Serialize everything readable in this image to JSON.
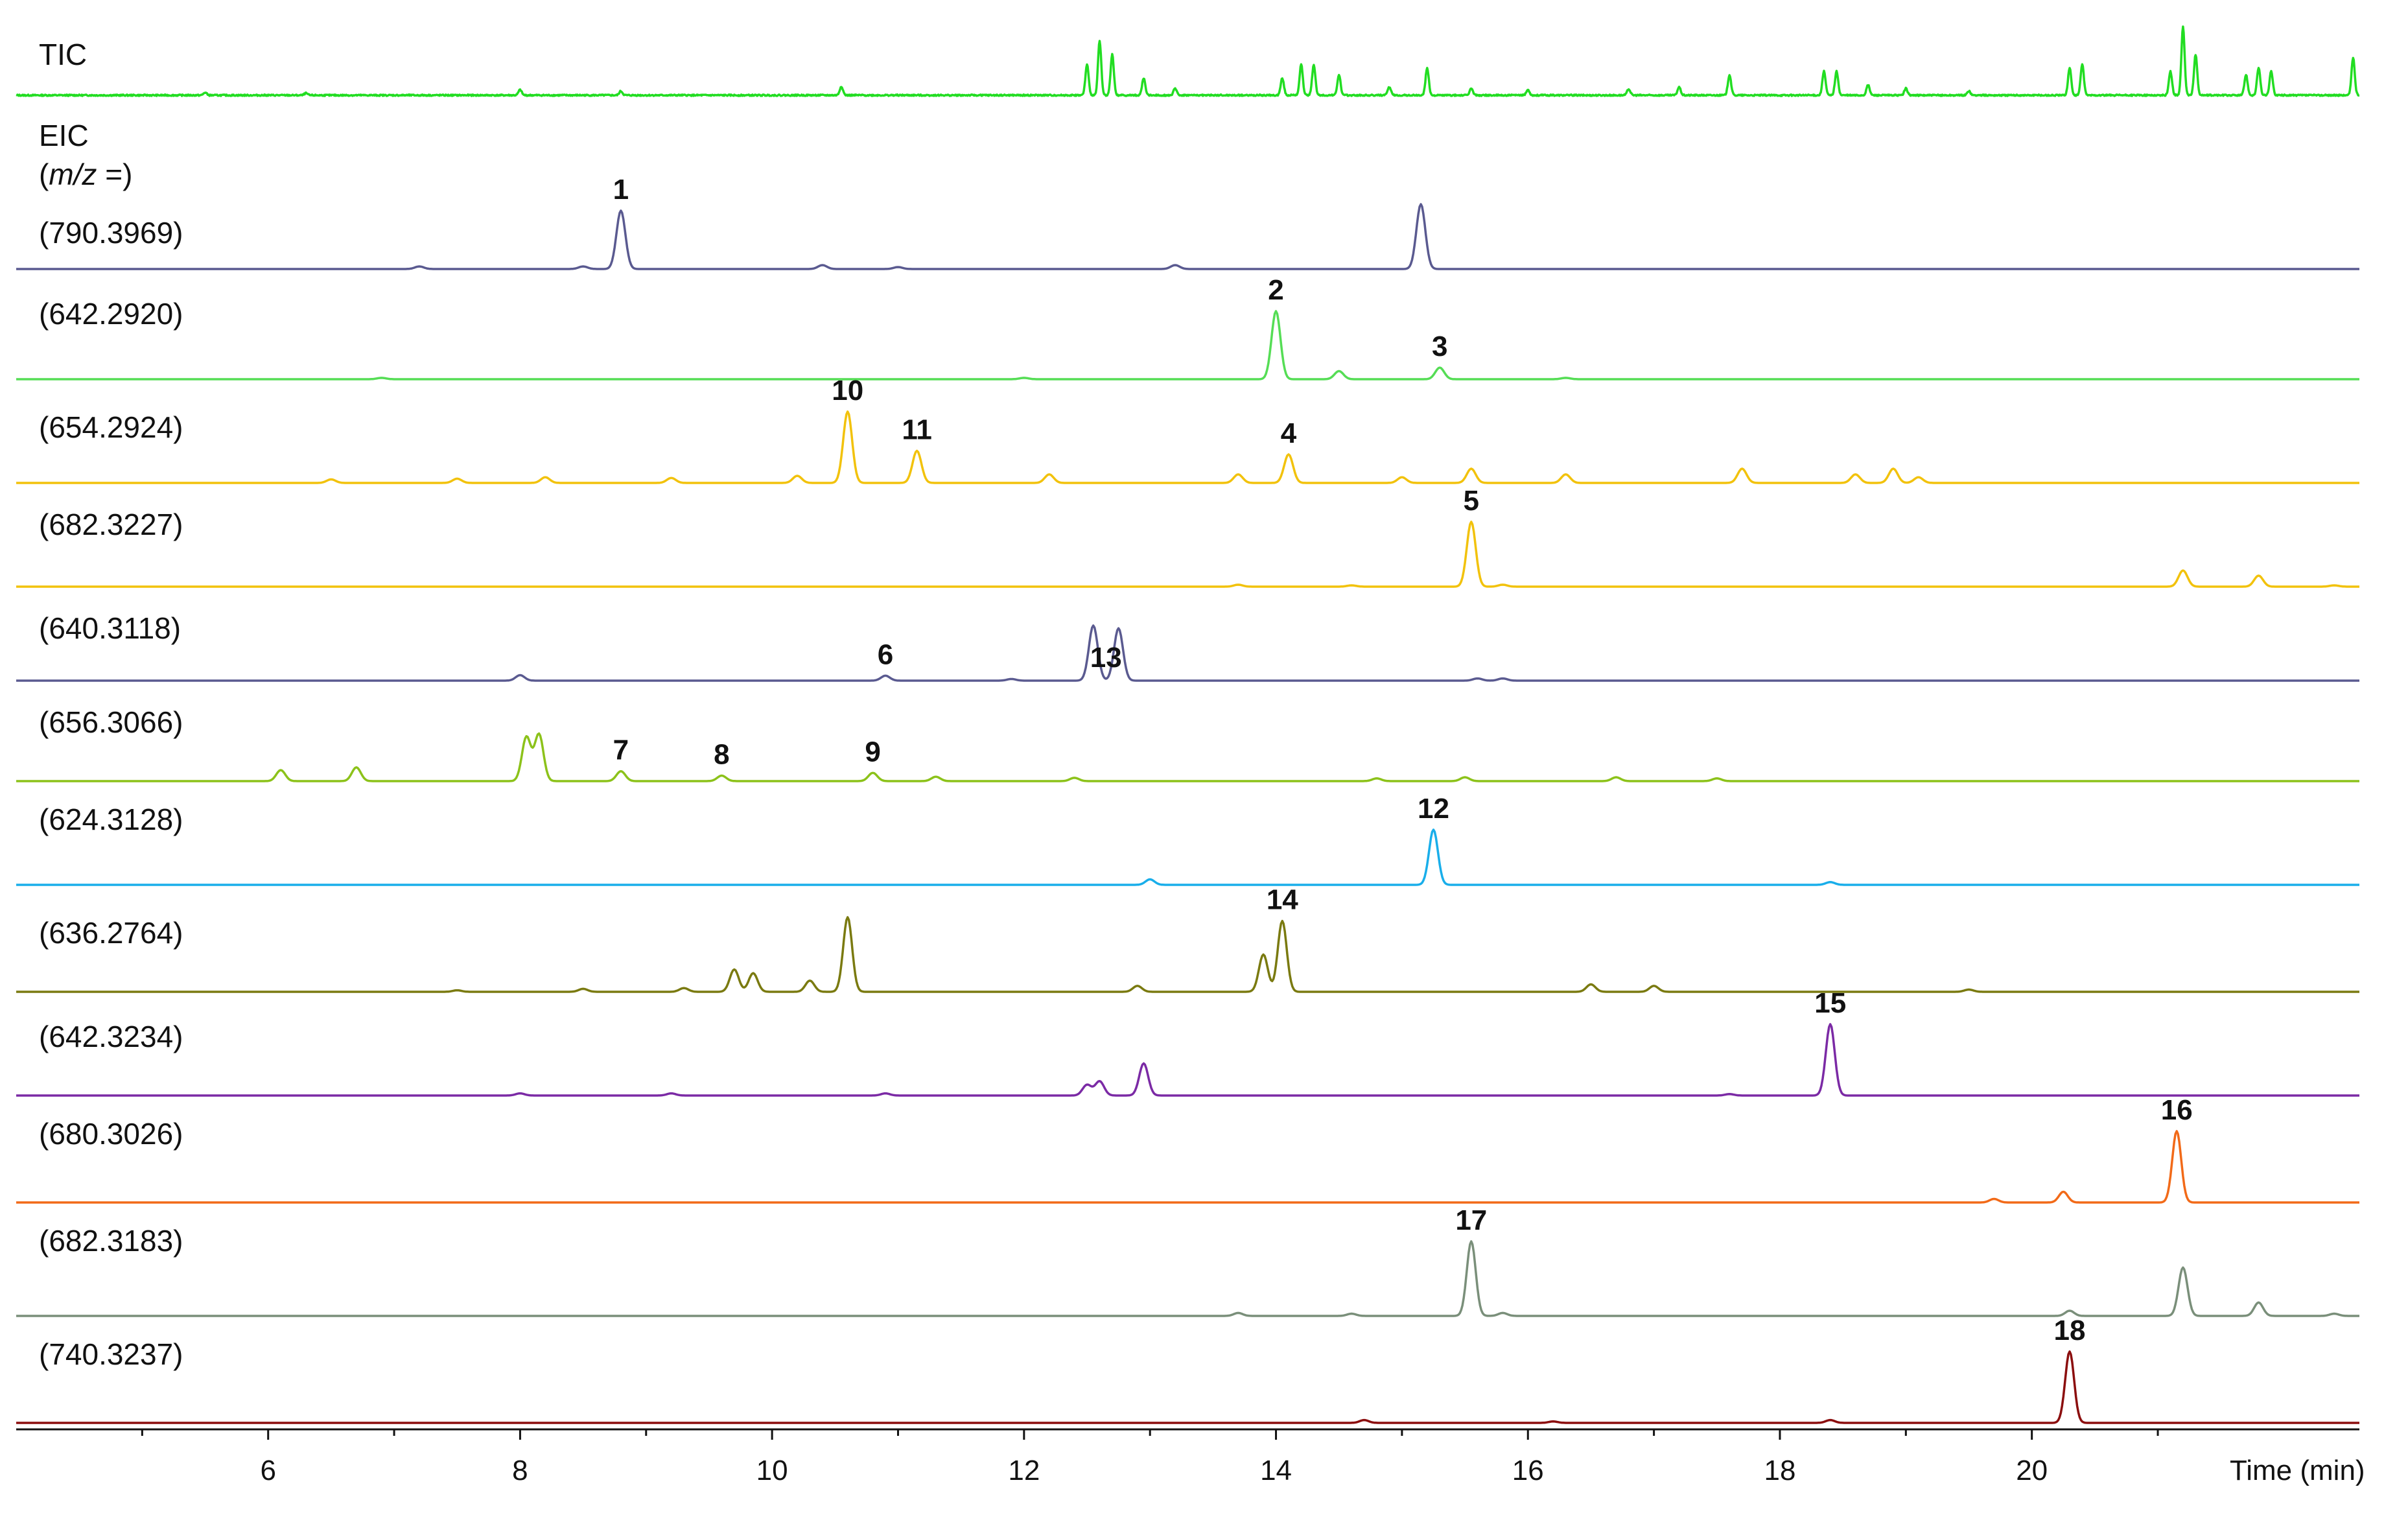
{
  "chart_data": {
    "type": "line",
    "x_axis": {
      "label": "Time (min)",
      "range": [
        4.0,
        22.6
      ],
      "major_ticks": [
        6,
        8,
        10,
        12,
        14,
        16,
        18,
        20
      ],
      "minor_ticks": [
        5,
        7,
        9,
        11,
        13,
        15,
        17,
        19,
        21
      ]
    },
    "traces": [
      {
        "id": "tic",
        "label": "TIC",
        "color": "#22dd22",
        "baseline": 0.02,
        "peaks": [
          [
            5.5,
            0.04
          ],
          [
            6.3,
            0.03
          ],
          [
            8.0,
            0.08
          ],
          [
            8.8,
            0.06
          ],
          [
            10.55,
            0.13
          ],
          [
            12.5,
            0.45
          ],
          [
            12.6,
            0.8
          ],
          [
            12.7,
            0.6
          ],
          [
            12.95,
            0.25
          ],
          [
            13.2,
            0.1
          ],
          [
            14.05,
            0.25
          ],
          [
            14.2,
            0.45
          ],
          [
            14.3,
            0.45
          ],
          [
            14.5,
            0.3
          ],
          [
            14.9,
            0.12
          ],
          [
            15.2,
            0.4
          ],
          [
            15.55,
            0.1
          ],
          [
            16.0,
            0.08
          ],
          [
            16.8,
            0.09
          ],
          [
            17.2,
            0.12
          ],
          [
            17.6,
            0.3
          ],
          [
            18.35,
            0.35
          ],
          [
            18.45,
            0.35
          ],
          [
            18.7,
            0.15
          ],
          [
            19.0,
            0.1
          ],
          [
            19.5,
            0.06
          ],
          [
            20.3,
            0.4
          ],
          [
            20.4,
            0.45
          ],
          [
            21.1,
            0.35
          ],
          [
            21.2,
            1.0
          ],
          [
            21.3,
            0.6
          ],
          [
            21.7,
            0.3
          ],
          [
            21.8,
            0.4
          ],
          [
            21.9,
            0.35
          ],
          [
            22.55,
            0.55
          ]
        ]
      },
      {
        "id": "eic",
        "label_line1": "EIC",
        "label_line2": "(m/z =)"
      },
      {
        "id": "t790",
        "label": "(790.3969)",
        "color": "#5a5a90",
        "peaks": [
          [
            7.2,
            0.04
          ],
          [
            8.5,
            0.04
          ],
          [
            8.8,
            0.9
          ],
          [
            10.4,
            0.06
          ],
          [
            11.0,
            0.03
          ],
          [
            13.2,
            0.06
          ],
          [
            15.15,
            1.0
          ]
        ],
        "annotations": [
          {
            "number": "1",
            "x": 8.8
          }
        ]
      },
      {
        "id": "t642a",
        "label": "(642.2920)",
        "color": "#55dd55",
        "peaks": [
          [
            6.9,
            0.02
          ],
          [
            12.0,
            0.02
          ],
          [
            14.0,
            1.0
          ],
          [
            14.5,
            0.12
          ],
          [
            15.3,
            0.17
          ],
          [
            16.3,
            0.02
          ]
        ],
        "annotations": [
          {
            "number": "2",
            "x": 14.0
          },
          {
            "number": "3",
            "x": 15.3
          }
        ]
      },
      {
        "id": "t654",
        "label": "(654.2924)",
        "color": "#f2c20c",
        "peaks": [
          [
            6.5,
            0.05
          ],
          [
            7.5,
            0.06
          ],
          [
            8.2,
            0.08
          ],
          [
            9.2,
            0.07
          ],
          [
            10.2,
            0.1
          ],
          [
            10.6,
            1.0
          ],
          [
            11.15,
            0.45
          ],
          [
            12.2,
            0.12
          ],
          [
            13.7,
            0.12
          ],
          [
            14.1,
            0.4
          ],
          [
            15.0,
            0.08
          ],
          [
            15.55,
            0.2
          ],
          [
            16.3,
            0.12
          ],
          [
            17.7,
            0.2
          ],
          [
            18.6,
            0.12
          ],
          [
            18.9,
            0.2
          ],
          [
            19.1,
            0.08
          ]
        ],
        "annotations": [
          {
            "number": "10",
            "x": 10.6
          },
          {
            "number": "11",
            "x": 11.15
          },
          {
            "number": "4",
            "x": 14.1
          }
        ]
      },
      {
        "id": "t682a",
        "label": "(682.3227)",
        "color": "#f2c20c",
        "peaks": [
          [
            13.7,
            0.03
          ],
          [
            14.6,
            0.02
          ],
          [
            15.55,
            1.0
          ],
          [
            15.8,
            0.03
          ],
          [
            21.2,
            0.25
          ],
          [
            21.8,
            0.17
          ],
          [
            22.4,
            0.02
          ]
        ],
        "annotations": [
          {
            "number": "5",
            "x": 15.55
          }
        ]
      },
      {
        "id": "t640",
        "label": "(640.3118)",
        "color": "#5a5a90",
        "peaks": [
          [
            8.0,
            0.1
          ],
          [
            10.9,
            0.09
          ],
          [
            11.9,
            0.03
          ],
          [
            12.55,
            1.0
          ],
          [
            12.75,
            0.95
          ],
          [
            15.6,
            0.04
          ],
          [
            15.8,
            0.04
          ]
        ],
        "annotations": [
          {
            "number": "6",
            "x": 10.9
          },
          {
            "number": "13",
            "x": 12.65
          }
        ]
      },
      {
        "id": "t656",
        "label": "(656.3066)",
        "color": "#8cc21a",
        "peaks": [
          [
            6.1,
            0.2
          ],
          [
            6.7,
            0.25
          ],
          [
            8.05,
            0.8
          ],
          [
            8.15,
            0.85
          ],
          [
            8.8,
            0.18
          ],
          [
            9.6,
            0.1
          ],
          [
            10.8,
            0.15
          ],
          [
            11.3,
            0.08
          ],
          [
            12.4,
            0.06
          ],
          [
            14.8,
            0.05
          ],
          [
            15.5,
            0.07
          ],
          [
            16.7,
            0.07
          ],
          [
            17.5,
            0.05
          ]
        ],
        "annotations": [
          {
            "number": "7",
            "x": 8.8
          },
          {
            "number": "8",
            "x": 9.6
          },
          {
            "number": "9",
            "x": 10.8
          }
        ]
      },
      {
        "id": "t624",
        "label": "(624.3128)",
        "color": "#19aeea",
        "peaks": [
          [
            13.0,
            0.1
          ],
          [
            15.25,
            1.0
          ],
          [
            18.4,
            0.05
          ]
        ],
        "annotations": [
          {
            "number": "12",
            "x": 15.25
          }
        ]
      },
      {
        "id": "t636",
        "label": "(636.2764)",
        "color": "#7a7a10",
        "peaks": [
          [
            7.5,
            0.02
          ],
          [
            8.5,
            0.04
          ],
          [
            9.3,
            0.05
          ],
          [
            9.7,
            0.3
          ],
          [
            9.85,
            0.25
          ],
          [
            10.3,
            0.15
          ],
          [
            10.6,
            1.0
          ],
          [
            12.9,
            0.08
          ],
          [
            13.9,
            0.5
          ],
          [
            14.05,
            0.95
          ],
          [
            16.5,
            0.1
          ],
          [
            17.0,
            0.08
          ],
          [
            19.5,
            0.03
          ]
        ],
        "annotations": [
          {
            "number": "14",
            "x": 14.05
          }
        ]
      },
      {
        "id": "t642b",
        "label": "(642.3234)",
        "color": "#7b2aa5",
        "peaks": [
          [
            8.0,
            0.03
          ],
          [
            9.2,
            0.03
          ],
          [
            10.9,
            0.03
          ],
          [
            12.5,
            0.15
          ],
          [
            12.6,
            0.2
          ],
          [
            12.95,
            0.45
          ],
          [
            17.6,
            0.02
          ],
          [
            18.4,
            1.0
          ]
        ],
        "annotations": [
          {
            "number": "15",
            "x": 18.4
          }
        ]
      },
      {
        "id": "t680",
        "label": "(680.3026)",
        "color": "#f26a18",
        "peaks": [
          [
            19.7,
            0.05
          ],
          [
            20.25,
            0.15
          ],
          [
            21.15,
            1.0
          ]
        ],
        "annotations": [
          {
            "number": "16",
            "x": 21.15
          }
        ]
      },
      {
        "id": "t682b",
        "label": "(682.3183)",
        "color": "#7a8f7a",
        "peaks": [
          [
            13.7,
            0.04
          ],
          [
            14.6,
            0.03
          ],
          [
            15.55,
            1.0
          ],
          [
            15.8,
            0.04
          ],
          [
            20.3,
            0.07
          ],
          [
            21.2,
            0.65
          ],
          [
            21.8,
            0.18
          ],
          [
            22.4,
            0.03
          ]
        ],
        "annotations": [
          {
            "number": "17",
            "x": 15.55
          }
        ]
      },
      {
        "id": "t740",
        "label": "(740.3237)",
        "color": "#8b0e0e",
        "peaks": [
          [
            14.7,
            0.04
          ],
          [
            16.2,
            0.02
          ],
          [
            18.4,
            0.04
          ],
          [
            20.3,
            1.0
          ]
        ],
        "annotations": [
          {
            "number": "18",
            "x": 20.3
          }
        ]
      }
    ]
  }
}
